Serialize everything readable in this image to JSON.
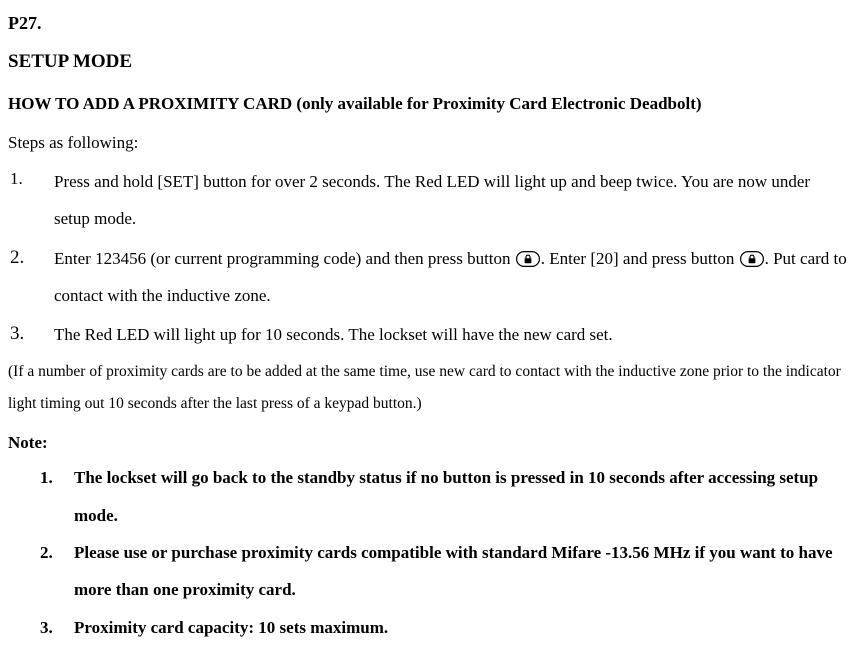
{
  "page_label": "P27.",
  "setup_mode_title": "SETUP MODE",
  "subtitle": "HOW TO ADD A PROXIMITY CARD (only available for Proximity Card Electronic Deadbolt)",
  "steps_intro": "Steps as following:",
  "steps": [
    {
      "num": "1.",
      "text": "Press and hold [SET] button for over 2 seconds. The Red LED will light up and beep twice. You are now under setup mode."
    },
    {
      "num": "2.",
      "text_a": "Enter 123456 (or current programming code) and then press button ",
      "text_b": ". Enter [20] and press button ",
      "text_c": ". Put card to contact with the inductive zone."
    },
    {
      "num": "3.",
      "text": "The Red LED will light up for 10 seconds. The lockset will have the new card set."
    }
  ],
  "paren_note": "(If a number of proximity cards are to be added at the same time, use new card to contact with the inductive zone prior to the indicator light timing out 10 seconds after the last press of a keypad button.)",
  "note_label": "Note:",
  "notes": [
    {
      "num": "1.",
      "text": "The lockset will go back to the standby status if no button is pressed in 10 seconds after accessing setup mode."
    },
    {
      "num": "2.",
      "text": "Please use or purchase proximity cards compatible with standard Mifare -13.56 MHz if you want to have more than one proximity card."
    },
    {
      "num": "3.",
      "text": "Proximity card capacity: 10 sets maximum."
    }
  ],
  "icons": {
    "lock": "lock-icon"
  }
}
